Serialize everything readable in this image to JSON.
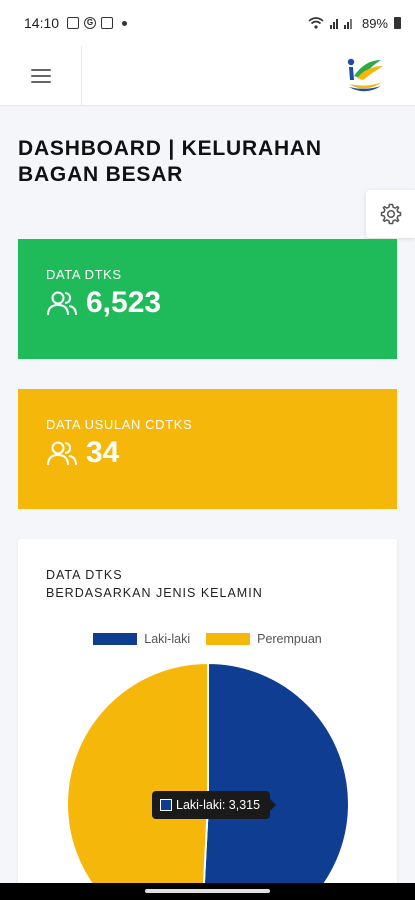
{
  "status_bar": {
    "time": "14:10",
    "notification_icons": [
      "image-icon",
      "google-icon",
      "instagram-icon"
    ],
    "battery": "89%"
  },
  "header": {
    "menu_icon": "hamburger-icon",
    "logo": "kemensos-logo"
  },
  "page": {
    "title": "DASHBOARD | KELURAHAN BAGAN BESAR"
  },
  "cards": [
    {
      "label": "DATA DTKS",
      "value": "6,523",
      "icon": "users-icon",
      "color": "#1fbb5a"
    },
    {
      "label": "DATA USULAN CDTKS",
      "value": "34",
      "icon": "users-icon",
      "color": "#f5b80a"
    }
  ],
  "chart_card": {
    "title_line1": "DATA DTKS",
    "title_line2": "BERDASARKAN JENIS KELAMIN",
    "tooltip": "Laki-laki: 3,315"
  },
  "chart_data": {
    "type": "pie",
    "title": "DATA DTKS BERDASARKAN JENIS KELAMIN",
    "legend_position": "top",
    "categories": [
      "Laki-laki",
      "Perempuan"
    ],
    "values": [
      3315,
      3208
    ],
    "colors": [
      "#0f3d91",
      "#f5b80a"
    ]
  }
}
